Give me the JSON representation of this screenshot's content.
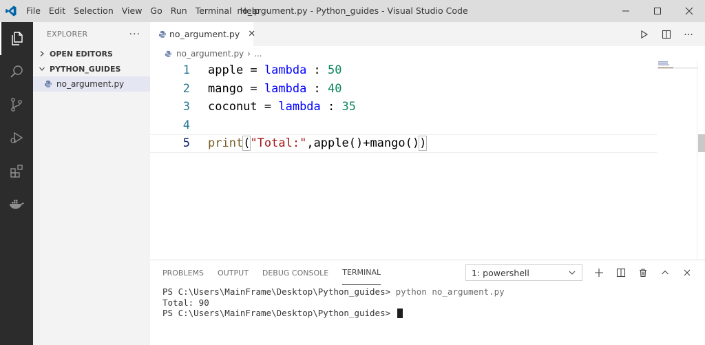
{
  "window": {
    "title": "no_argument.py - Python_guides - Visual Studio Code",
    "menu": [
      "File",
      "Edit",
      "Selection",
      "View",
      "Go",
      "Run",
      "Terminal",
      "Help"
    ],
    "minimize": "–",
    "maximize": "☐",
    "close": "✕"
  },
  "sidebar": {
    "title": "EXPLORER",
    "more": "···",
    "sections": [
      {
        "label": "OPEN EDITORS",
        "expanded": false
      },
      {
        "label": "PYTHON_GUIDES",
        "expanded": true
      }
    ],
    "files": [
      {
        "name": "no_argument.py",
        "selected": true
      }
    ]
  },
  "editor": {
    "tab": {
      "label": "no_argument.py",
      "close": "✕"
    },
    "breadcrumb": {
      "file": "no_argument.py",
      "sep": "›",
      "more": "..."
    },
    "lines": [
      {
        "num": "1",
        "a": "apple = ",
        "kw": "lambda",
        "b": " : ",
        "n": "50"
      },
      {
        "num": "2",
        "a": "mango = ",
        "kw": "lambda",
        "b": " : ",
        "n": "40"
      },
      {
        "num": "3",
        "a": "coconut = ",
        "kw": "lambda",
        "b": " : ",
        "n": "35"
      },
      {
        "num": "4"
      },
      {
        "num": "5",
        "print": "print",
        "open": "(",
        "str": "\"Total:\"",
        "rest": ",apple()+mango()",
        "close": ")"
      }
    ]
  },
  "panel": {
    "tabs": [
      "PROBLEMS",
      "OUTPUT",
      "DEBUG CONSOLE",
      "TERMINAL"
    ],
    "active_tab": "TERMINAL",
    "terminal_select": "1: powershell",
    "terminal_lines": [
      {
        "prompt": "PS C:\\Users\\MainFrame\\Desktop\\Python_guides> ",
        "cmd": "python no_argument.py"
      },
      {
        "text": "Total: 90"
      },
      {
        "prompt": "PS C:\\Users\\MainFrame\\Desktop\\Python_guides> "
      }
    ]
  },
  "colors": {
    "accent": "#0065a9",
    "keyword": "#0000ff",
    "number": "#098658",
    "string": "#a31515",
    "function": "#795e26",
    "line_number": "#237893"
  }
}
